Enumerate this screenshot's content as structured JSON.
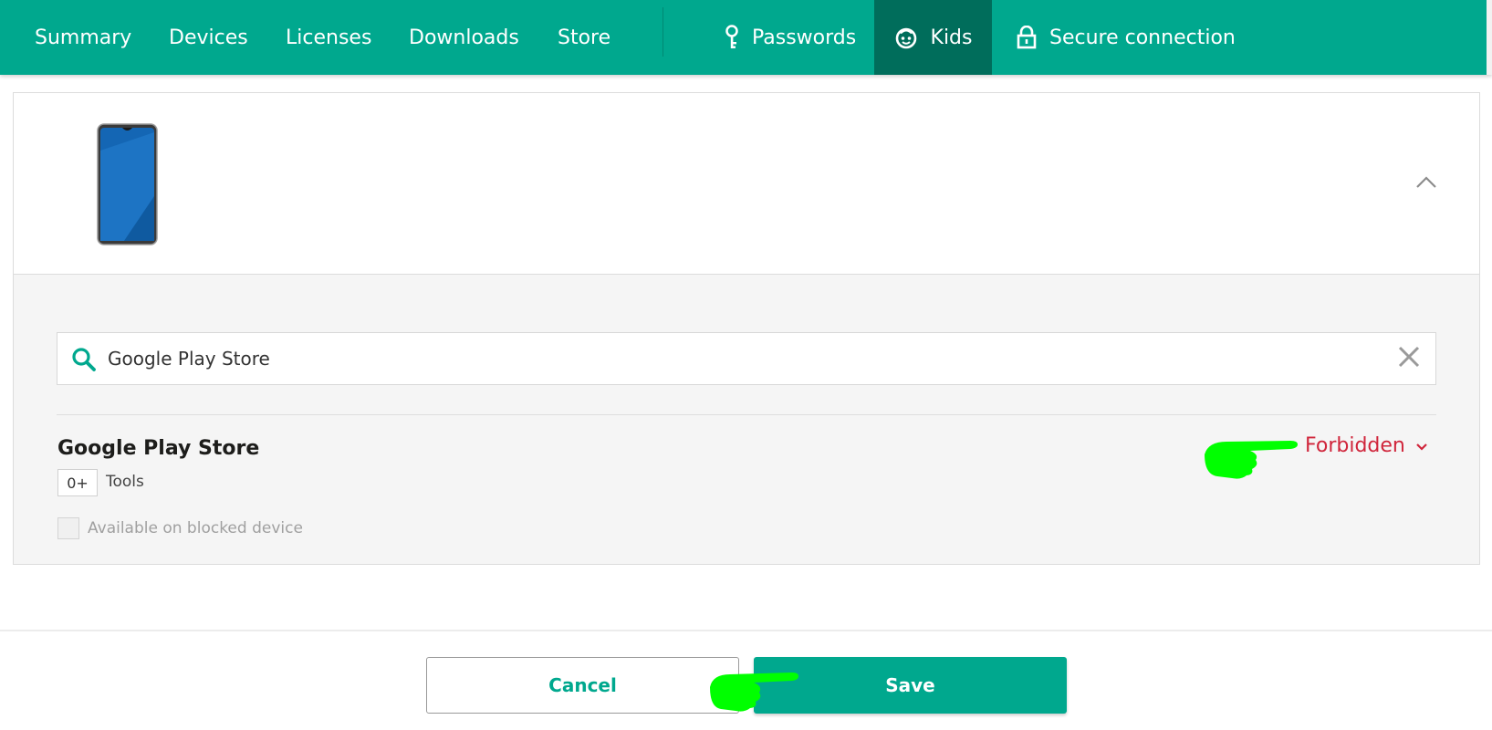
{
  "nav": {
    "items": [
      {
        "label": "Summary"
      },
      {
        "label": "Devices"
      },
      {
        "label": "Licenses"
      },
      {
        "label": "Downloads"
      },
      {
        "label": "Store"
      }
    ],
    "right_items": [
      {
        "label": "Passwords",
        "icon": "key-icon"
      },
      {
        "label": "Kids",
        "icon": "kids-face-icon",
        "active": true
      },
      {
        "label": "Secure connection",
        "icon": "lock-icon"
      }
    ]
  },
  "device": {
    "image": "smartphone-icon",
    "collapse_icon": "chevron-up-icon"
  },
  "search": {
    "value": "Google Play Store",
    "icon": "search-icon",
    "clear_icon": "close-icon"
  },
  "app": {
    "name": "Google Play Store",
    "age_rating": "0+",
    "category": "Tools",
    "status": "Forbidden",
    "status_icon": "chevron-down-icon",
    "blocked_checkbox_label": "Available on blocked device",
    "blocked_checked": false
  },
  "footer": {
    "cancel_label": "Cancel",
    "save_label": "Save"
  },
  "colors": {
    "brand": "#00a88e",
    "brand_dark": "#006d5b",
    "forbidden": "#d0253b",
    "annotation_highlight": "#00ff00"
  }
}
